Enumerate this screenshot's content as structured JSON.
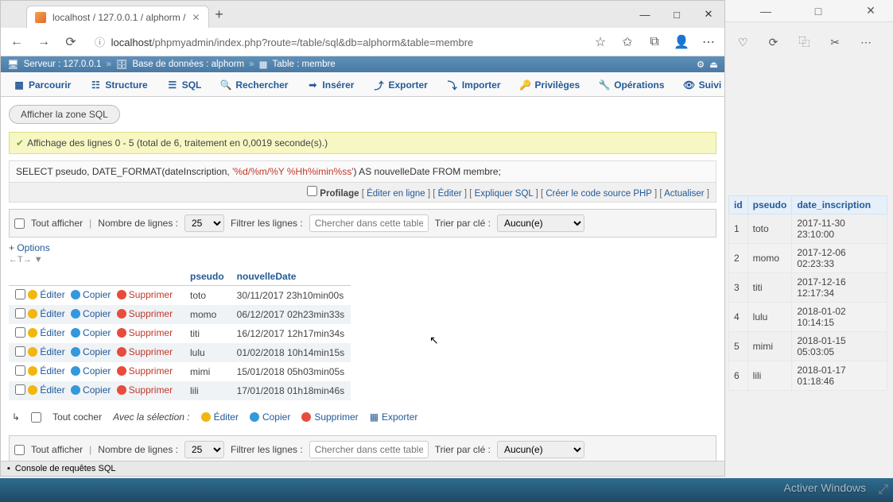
{
  "outerWindow": {
    "minimize": "—",
    "maximize": "□",
    "close": "✕"
  },
  "tab": {
    "title": "localhost / 127.0.0.1 / alphorm /",
    "close": "✕",
    "plus": "+"
  },
  "winCtrls": {
    "min": "—",
    "max": "□",
    "close": "✕"
  },
  "nav": {
    "back": "←",
    "fwd": "→",
    "reload": "⟳"
  },
  "url": {
    "lock": "ⓘ",
    "host": "localhost",
    "path": "/phpmyadmin/index.php?route=/table/sql&db=alphorm&table=membre"
  },
  "addrIcons": {
    "star": "☆",
    "fav": "✩",
    "collect": "⧉",
    "user": "👤",
    "menu": "⋯"
  },
  "breadcrumb": {
    "server_label": "Serveur :",
    "server_val": "127.0.0.1",
    "db_label": "Base de données :",
    "db_val": "alphorm",
    "table_label": "Table :",
    "table_val": "membre",
    "sep": "»"
  },
  "tabs": {
    "browse": "Parcourir",
    "structure": "Structure",
    "sql": "SQL",
    "search": "Rechercher",
    "insert": "Insérer",
    "export": "Exporter",
    "import": "Importer",
    "privileges": "Privilèges",
    "operations": "Opérations",
    "tracking": "Suivi"
  },
  "sqlZone": "Afficher la zone SQL",
  "notice": "Affichage des lignes 0 - 5 (total de 6, traitement en 0,0019 seconde(s).)",
  "sql": {
    "pre": "SELECT pseudo, DATE_FORMAT(dateInscription, ",
    "str": "'%d/%m/%Y %Hh%imin%ss'",
    "post": ") AS nouvelleDate FROM membre;"
  },
  "profBar": {
    "profiling": "Profilage",
    "editInline": "Éditer en ligne",
    "edit": "Éditer",
    "explain": "Expliquer SQL",
    "php": "Créer le code source PHP",
    "refresh": "Actualiser"
  },
  "filter": {
    "showAll": "Tout afficher",
    "rowsLabel": "Nombre de lignes :",
    "rowsVal": "25",
    "filterLabel": "Filtrer les lignes :",
    "searchPlaceholder": "Chercher dans cette table",
    "sortLabel": "Trier par clé :",
    "sortVal": "Aucun(e)"
  },
  "optionsLabel": "+ Options",
  "cols": {
    "pseudo": "pseudo",
    "nouvelleDate": "nouvelleDate"
  },
  "actions": {
    "edit": "Éditer",
    "copy": "Copier",
    "delete": "Supprimer"
  },
  "rows": [
    {
      "pseudo": "toto",
      "date": "30/11/2017 23h10min00s"
    },
    {
      "pseudo": "momo",
      "date": "06/12/2017 02h23min33s"
    },
    {
      "pseudo": "titi",
      "date": "16/12/2017 12h17min34s"
    },
    {
      "pseudo": "lulu",
      "date": "01/02/2018 10h14min15s"
    },
    {
      "pseudo": "mimi",
      "date": "15/01/2018 05h03min05s"
    },
    {
      "pseudo": "lili",
      "date": "17/01/2018 01h18min46s"
    }
  ],
  "batch": {
    "checkAll": "Tout cocher",
    "withSel": "Avec la sélection :",
    "edit": "Éditer",
    "copy": "Copier",
    "delete": "Supprimer",
    "export": "Exporter"
  },
  "console": "Console de requêtes SQL",
  "activate": "Activer Windows",
  "rightIcons": {
    "heart": "♡",
    "refresh": "⟳",
    "crop": "⿻",
    "cut": "✂",
    "more": "⋯"
  },
  "rightTable": {
    "headers": {
      "id": "id",
      "pseudo": "pseudo",
      "date": "date_inscription"
    },
    "rows": [
      {
        "id": "1",
        "pseudo": "toto",
        "date": "2017-11-30 23:10:00"
      },
      {
        "id": "2",
        "pseudo": "momo",
        "date": "2017-12-06 02:23:33"
      },
      {
        "id": "3",
        "pseudo": "titi",
        "date": "2017-12-16 12:17:34"
      },
      {
        "id": "4",
        "pseudo": "lulu",
        "date": "2018-01-02 10:14:15"
      },
      {
        "id": "5",
        "pseudo": "mimi",
        "date": "2018-01-15 05:03:05"
      },
      {
        "id": "6",
        "pseudo": "lili",
        "date": "2018-01-17 01:18:46"
      }
    ]
  }
}
